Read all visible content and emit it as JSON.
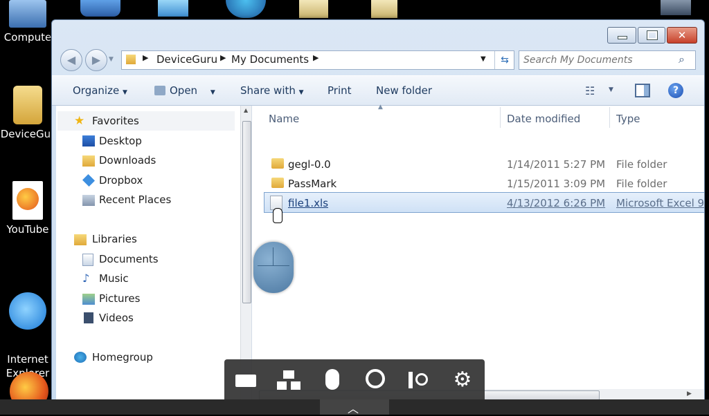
{
  "desktop": {
    "icons": [
      {
        "label": "Compute",
        "icon": "computer-icon"
      },
      {
        "label": "DeviceGur",
        "icon": "user-folder-icon"
      },
      {
        "label": "YouTube",
        "icon": "firefox-shortcut-icon"
      },
      {
        "label": "Internet\nExplorer",
        "icon": "internet-explorer-icon"
      }
    ]
  },
  "window": {
    "breadcrumb": [
      "DeviceGuru",
      "My Documents"
    ],
    "search_placeholder": "Search My Documents",
    "toolbar": {
      "organize": "Organize",
      "open": "Open",
      "share_with": "Share with",
      "print": "Print",
      "new_folder": "New folder"
    },
    "nav": {
      "favorites": "Favorites",
      "favorites_items": [
        "Desktop",
        "Downloads",
        "Dropbox",
        "Recent Places"
      ],
      "libraries": "Libraries",
      "libraries_items": [
        "Documents",
        "Music",
        "Pictures",
        "Videos"
      ],
      "homegroup": "Homegroup"
    },
    "columns": {
      "name": "Name",
      "date": "Date modified",
      "type": "Type"
    },
    "files": [
      {
        "name": "gegl-0.0",
        "date": "1/14/2011 5:27 PM",
        "type": "File folder",
        "kind": "folder"
      },
      {
        "name": "PassMark",
        "date": "1/15/2011 3:09 PM",
        "type": "File folder",
        "kind": "folder"
      },
      {
        "name": "file1.xls",
        "date": "4/13/2012 6:26 PM",
        "type": "Microsoft Excel 9",
        "kind": "xls",
        "selected": true
      }
    ]
  },
  "colors": {
    "window_chrome": "#c8dbef",
    "selection": "#cfe1f6",
    "control_bar": "#343434"
  }
}
